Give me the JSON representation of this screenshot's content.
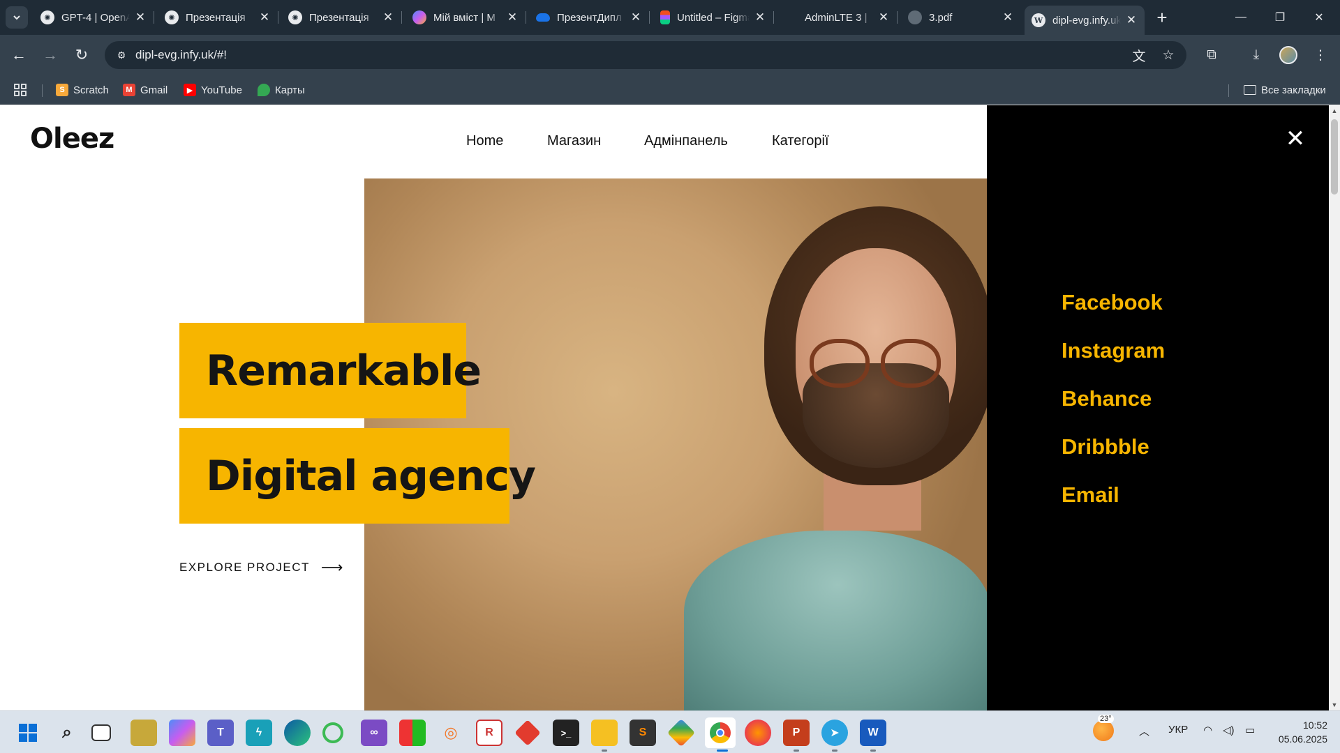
{
  "browser": {
    "tabs": [
      {
        "title": "GPT-4 | OpenAI",
        "icon": "openai-icon",
        "color": "#e8eaed"
      },
      {
        "title": "Презентація",
        "icon": "openai-icon",
        "color": "#e8eaed"
      },
      {
        "title": "Презентація",
        "icon": "openai-icon",
        "color": "#e8eaed"
      },
      {
        "title": "Мій вміст | M",
        "icon": "copilot-icon",
        "color": "#8a5cf6"
      },
      {
        "title": "ПрезентДипл",
        "icon": "onedrive-icon",
        "color": "#1a73e8"
      },
      {
        "title": "Untitled – Figma",
        "icon": "figma-icon",
        "color": "#f24e1e"
      },
      {
        "title": "AdminLTE 3 |",
        "icon": "adminlte-icon",
        "color": "#3c4b5a"
      },
      {
        "title": "3.pdf",
        "icon": "globe-icon",
        "color": "#8a939c"
      },
      {
        "title": "dipl-evg.infy.uk",
        "icon": "wordpress-icon",
        "color": "#e8eaed"
      }
    ],
    "active_tab_index": 8,
    "url": "dipl-evg.infy.uk/#!",
    "bookmarks": [
      {
        "label": "Scratch",
        "icon": "scratch-icon",
        "color": "#f7a93b"
      },
      {
        "label": "Gmail",
        "icon": "gmail-icon",
        "color": "#ea4335"
      },
      {
        "label": "YouTube",
        "icon": "youtube-icon",
        "color": "#ff0000"
      },
      {
        "label": "Карты",
        "icon": "maps-icon",
        "color": "#34a853"
      }
    ],
    "all_bookmarks": "Все закладки"
  },
  "site": {
    "logo": "Oleez",
    "nav": {
      "home": "Home",
      "shop": "Магазин",
      "admin": "Адмінпанель",
      "categories": "Категорії"
    },
    "hero": {
      "line1": "Remarkable",
      "line2": "Digital agency",
      "cta": "EXPLORE PROJECT",
      "cta_arrow": "⟶"
    },
    "side_menu": {
      "close": "✕",
      "links": [
        "Facebook",
        "Instagram",
        "Behance",
        "Dribbble",
        "Email"
      ]
    },
    "colors": {
      "accent": "#f7b500",
      "panel": "#000000"
    }
  },
  "taskbar": {
    "weather_temp": "23°",
    "language": "УКР",
    "time": "10:52",
    "date": "05.06.2025"
  }
}
